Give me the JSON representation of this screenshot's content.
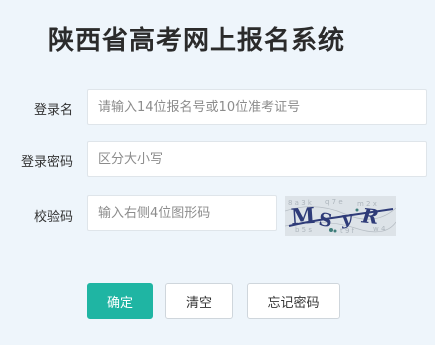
{
  "header": {
    "title": "陕西省高考网上报名系统"
  },
  "form": {
    "username": {
      "label": "登录名",
      "placeholder": "请输入14位报名号或10位准考证号",
      "value": ""
    },
    "password": {
      "label": "登录密码",
      "placeholder": "区分大小写",
      "value": ""
    },
    "captcha": {
      "label": "校验码",
      "placeholder": "输入右侧4位图形码",
      "value": "",
      "image_text": "MSYR"
    }
  },
  "actions": {
    "confirm_label": "确定",
    "clear_label": "清空",
    "forgot_label": "忘记密码"
  },
  "colors": {
    "background": "#eef5fb",
    "primary": "#1fb5a3",
    "title": "#2b2b2b",
    "captcha_ink": "#2e3b78"
  }
}
